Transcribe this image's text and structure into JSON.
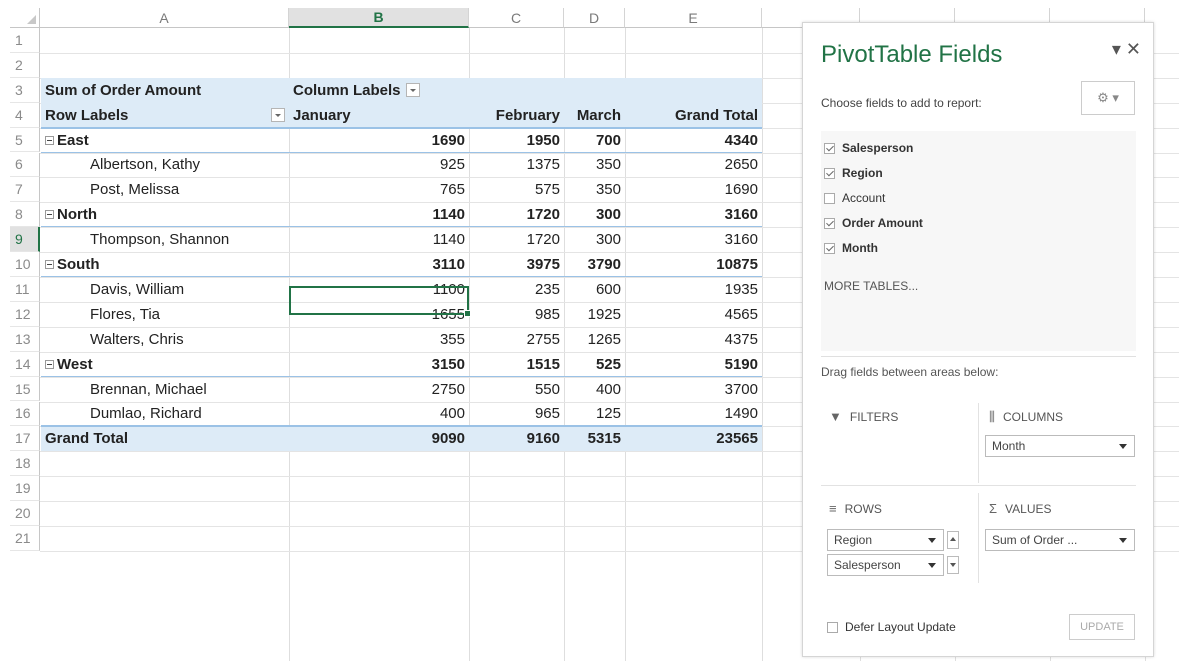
{
  "columns": [
    "A",
    "B",
    "C",
    "D",
    "E"
  ],
  "rows": [
    "1",
    "2",
    "3",
    "4",
    "5",
    "6",
    "7",
    "8",
    "9",
    "10",
    "11",
    "12",
    "13",
    "14",
    "15",
    "16",
    "17",
    "18",
    "19",
    "20",
    "21"
  ],
  "pivot": {
    "header1_a": "Sum of Order Amount",
    "header1_b": "Column Labels",
    "header2_a": "Row Labels",
    "header2_b": "January",
    "header2_c": "February",
    "header2_d": "March",
    "header2_e": "Grand Total",
    "lines": [
      {
        "label": "East",
        "bold": true,
        "group": true,
        "v": [
          "1690",
          "1950",
          "700",
          "4340"
        ]
      },
      {
        "label": "Albertson, Kathy",
        "bold": false,
        "group": false,
        "v": [
          "925",
          "1375",
          "350",
          "2650"
        ]
      },
      {
        "label": "Post, Melissa",
        "bold": false,
        "group": false,
        "v": [
          "765",
          "575",
          "350",
          "1690"
        ]
      },
      {
        "label": "North",
        "bold": true,
        "group": true,
        "v": [
          "1140",
          "1720",
          "300",
          "3160"
        ]
      },
      {
        "label": "Thompson, Shannon",
        "bold": false,
        "group": false,
        "v": [
          "1140",
          "1720",
          "300",
          "3160"
        ]
      },
      {
        "label": "South",
        "bold": true,
        "group": true,
        "v": [
          "3110",
          "3975",
          "3790",
          "10875"
        ]
      },
      {
        "label": "Davis, William",
        "bold": false,
        "group": false,
        "v": [
          "1100",
          "235",
          "600",
          "1935"
        ]
      },
      {
        "label": "Flores, Tia",
        "bold": false,
        "group": false,
        "v": [
          "1655",
          "985",
          "1925",
          "4565"
        ]
      },
      {
        "label": "Walters, Chris",
        "bold": false,
        "group": false,
        "v": [
          "355",
          "2755",
          "1265",
          "4375"
        ]
      },
      {
        "label": "West",
        "bold": true,
        "group": true,
        "v": [
          "3150",
          "1515",
          "525",
          "5190"
        ]
      },
      {
        "label": "Brennan, Michael",
        "bold": false,
        "group": false,
        "v": [
          "2750",
          "550",
          "400",
          "3700"
        ]
      },
      {
        "label": "Dumlao, Richard",
        "bold": false,
        "group": false,
        "v": [
          "400",
          "965",
          "125",
          "1490"
        ]
      }
    ],
    "grand_label": "Grand Total",
    "grand_values": [
      "9090",
      "9160",
      "5315",
      "23565"
    ]
  },
  "panel": {
    "title": "PivotTable Fields",
    "controls": "▾ ✕",
    "choose": "Choose fields to add to report:",
    "gear": "⚙ ▾",
    "fields": [
      {
        "label": "Salesperson",
        "checked": true
      },
      {
        "label": "Region",
        "checked": true
      },
      {
        "label": "Account",
        "checked": false
      },
      {
        "label": "Order Amount",
        "checked": true
      },
      {
        "label": "Month",
        "checked": true
      }
    ],
    "more_tables": "MORE TABLES...",
    "drag_text": "Drag fields between areas below:",
    "filters_label": "FILTERS",
    "columns_label": "COLUMNS",
    "rows_label": "ROWS",
    "values_label": "VALUES",
    "columns_field": "Month",
    "rows_field1": "Region",
    "rows_field2": "Salesperson",
    "values_field": "Sum of Order ...",
    "defer": "Defer Layout Update",
    "update": "UPDATE"
  },
  "colors": {
    "accent": "#217346",
    "pivot_band": "#ddebf7",
    "pivot_line": "#9bc2e6"
  }
}
